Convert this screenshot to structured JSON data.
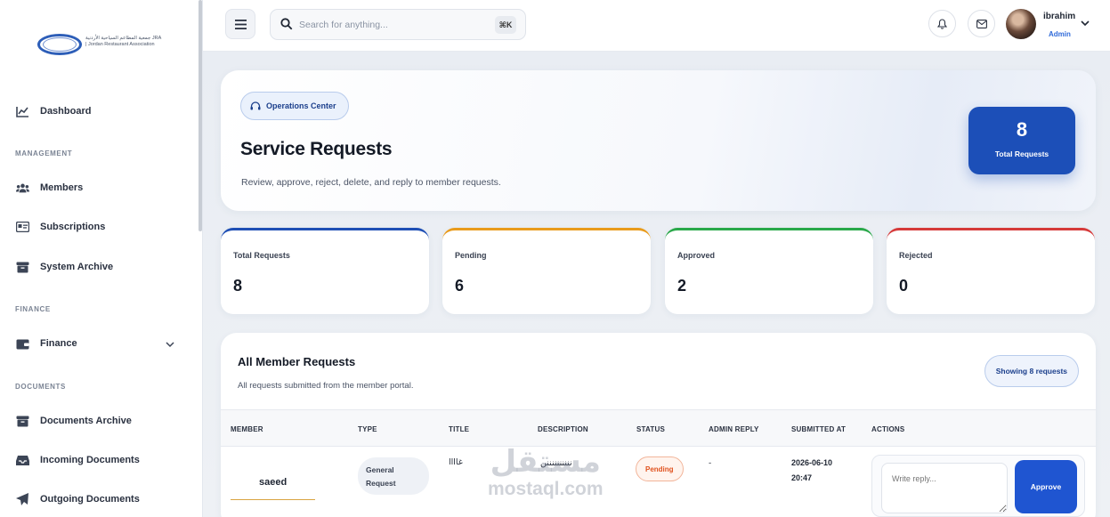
{
  "sidebar": {
    "logo_text": "جمعية المطاعم السياحية الأردنية JRA | Jordan Restaurant Association",
    "items": [
      {
        "label": "Dashboard",
        "icon": "chart-line-icon"
      },
      {
        "label": "Members",
        "icon": "users-icon"
      },
      {
        "label": "Subscriptions",
        "icon": "id-card-icon"
      },
      {
        "label": "System Archive",
        "icon": "archive-box-icon"
      },
      {
        "label": "Finance",
        "icon": "wallet-icon"
      },
      {
        "label": "Documents Archive",
        "icon": "archive-box-icon"
      },
      {
        "label": "Incoming Documents",
        "icon": "inbox-icon"
      },
      {
        "label": "Outgoing Documents",
        "icon": "paper-plane-icon"
      }
    ],
    "sections": [
      "MANAGEMENT",
      "FINANCE",
      "DOCUMENTS"
    ]
  },
  "topbar": {
    "search_placeholder": "Search for anything...",
    "shortcut": "⌘K",
    "user_name": "ibrahim",
    "user_role": "Admin"
  },
  "hero": {
    "badge": "Operations Center",
    "title": "Service Requests",
    "subtitle": "Review, approve, reject, delete, and reply to member requests.",
    "total_value": "8",
    "total_label": "Total Requests"
  },
  "stats": [
    {
      "label": "Total Requests",
      "value": "8",
      "color": "#1f4fb5"
    },
    {
      "label": "Pending",
      "value": "6",
      "color": "#e99b1c"
    },
    {
      "label": "Approved",
      "value": "2",
      "color": "#2aa84a"
    },
    {
      "label": "Rejected",
      "value": "0",
      "color": "#d63a3a"
    }
  ],
  "requests": {
    "title": "All Member Requests",
    "subtitle": "All requests submitted from the member portal.",
    "showing": "Showing 8 requests",
    "columns": [
      "MEMBER",
      "TYPE",
      "TITLE",
      "DESCRIPTION",
      "STATUS",
      "ADMIN REPLY",
      "SUBMITTED AT",
      "ACTIONS"
    ],
    "rows": [
      {
        "member": "saeed",
        "type_line1": "General",
        "type_line2": "Request",
        "title": "غاااا",
        "description": "ننننننننننن",
        "status": "Pending",
        "admin_reply": "-",
        "submitted_date": "2026-06-10",
        "submitted_time": "20:47",
        "reply_placeholder": "Write reply...",
        "approve_label": "Approve"
      }
    ]
  },
  "watermark": {
    "ar": "مستقل",
    "en": "mostaql.com"
  }
}
